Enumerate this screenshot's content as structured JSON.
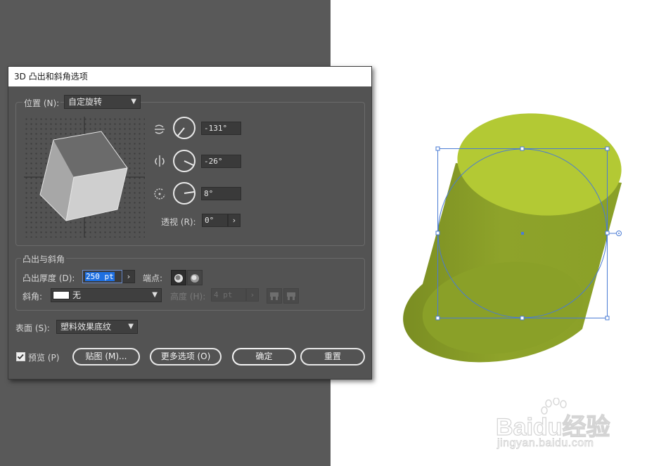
{
  "dialog": {
    "title": "3D 凸出和斜角选项",
    "position": {
      "label": "位置 (N):",
      "preset": "自定旋转",
      "rotation_x": "-131°",
      "rotation_y": "-26°",
      "rotation_z": "8°",
      "perspective_label": "透视 (R):",
      "perspective_value": "0°"
    },
    "extrude": {
      "group_label": "凸出与斜角",
      "depth_label": "凸出厚度 (D):",
      "depth_value": "250 pt",
      "cap_label": "端点:",
      "bevel_label": "斜角:",
      "bevel_value": "无",
      "height_label": "高度 (H):",
      "height_value": "4 pt"
    },
    "surface": {
      "label": "表面 (S):",
      "value": "塑料效果底纹"
    },
    "preview_label": "预览 (P)",
    "map_button": "贴图 (M)...",
    "more_options_button": "更多选项 (O)",
    "ok_button": "确定",
    "reset_button": "重置"
  },
  "watermark": {
    "brand": "Baidu经验",
    "url": "jingyan.baidu.com"
  },
  "colors": {
    "dialog_bg": "#535353",
    "canvas_bg": "#ffffff",
    "cylinder_top": "#b3c934",
    "cylinder_side": "#869a26",
    "selection": "#4a7bd4",
    "highlight": "#1e6fe0"
  }
}
